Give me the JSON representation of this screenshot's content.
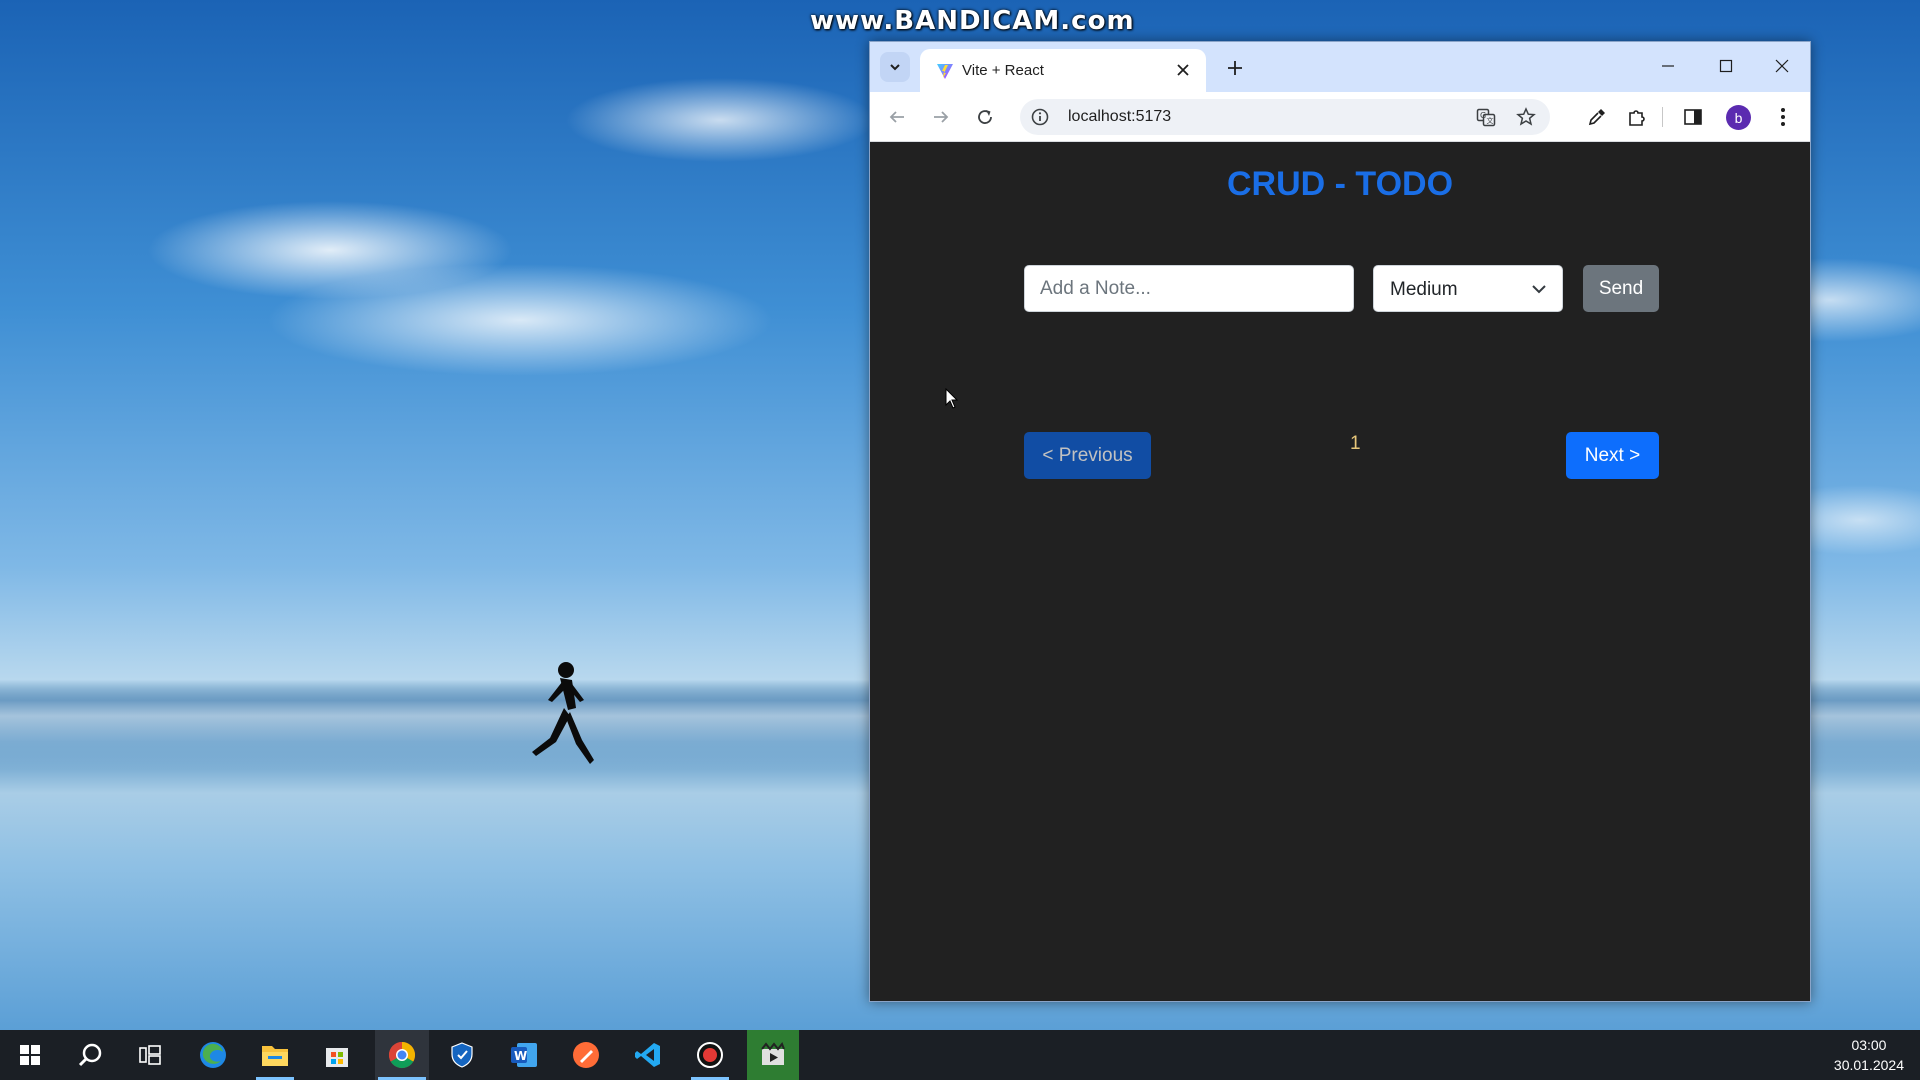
{
  "desktop": {
    "watermark": "www.BANDICAM.com"
  },
  "browser": {
    "tab": {
      "title": "Vite + React",
      "favicon": "vite-logo-icon"
    },
    "address_bar": {
      "url": "localhost:5173"
    },
    "profile_initial": "b",
    "icons": {
      "tab_search": "chevron-down-icon",
      "tab_close": "close-icon",
      "new_tab": "plus-icon",
      "minimize": "minimize-icon",
      "maximize": "maximize-icon",
      "close": "close-icon",
      "back": "arrow-left-icon",
      "forward": "arrow-right-icon",
      "reload": "reload-icon",
      "site_info": "info-icon",
      "translate": "translate-icon",
      "bookmark": "star-icon",
      "eyedropper": "eyedropper-icon",
      "extensions": "puzzle-icon",
      "side_panel": "side-panel-icon",
      "menu": "kebab-menu-icon"
    }
  },
  "app": {
    "title": "CRUD - TODO",
    "note_input": {
      "placeholder": "Add a Note...",
      "value": ""
    },
    "priority_select": {
      "selected": "Medium"
    },
    "send_label": "Send",
    "pagination": {
      "previous_label": "< Previous",
      "page": "1",
      "next_label": "Next >"
    },
    "colors": {
      "background": "#212121",
      "title": "#1a6ee6",
      "primary_button": "#0d6efd",
      "secondary_button": "#6c757d",
      "page_number": "#e8c77a"
    }
  },
  "taskbar": {
    "items": [
      "windows-start-icon",
      "search-icon",
      "task-view-icon",
      "edge-icon",
      "file-explorer-icon",
      "microsoft-store-icon",
      "chrome-icon",
      "security-shield-icon",
      "word-icon",
      "postman-icon",
      "vscode-icon",
      "bandicam-record-icon",
      "media-editor-icon"
    ],
    "clock": {
      "time": "03:00",
      "date": "30.01.2024"
    }
  }
}
